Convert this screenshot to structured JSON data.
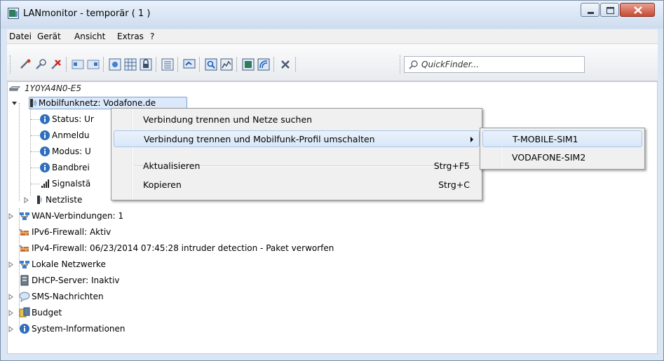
{
  "window": {
    "title": "LANmonitor - temporär ( 1 )"
  },
  "menubar": [
    "Datei",
    "Gerät",
    "Ansicht",
    "Extras",
    "?"
  ],
  "quickfinder": {
    "placeholder": "QuickFinder..."
  },
  "tree": {
    "device": "1Y0YA4N0-E5",
    "mobile": "Mobilfunknetz: Vodafone.de",
    "children": [
      "Status: Ur",
      "Anmeldu",
      "Modus: U",
      "Bandbrei",
      "Signalstä",
      "Netzliste"
    ],
    "root_items": [
      "WAN-Verbindungen: 1",
      "IPv6-Firewall: Aktiv",
      "IPv4-Firewall: 06/23/2014 07:45:28 intruder detection - Paket verworfen",
      "Lokale Netzwerke",
      "DHCP-Server: Inaktiv",
      "SMS-Nachrichten",
      "Budget",
      "System-Informationen"
    ]
  },
  "context_menu": {
    "items": [
      {
        "label": "Verbindung trennen und Netze suchen",
        "shortcut": ""
      },
      {
        "label": "Verbindung trennen und Mobilfunk-Profil umschalten",
        "shortcut": ""
      },
      {
        "label": "Aktualisieren",
        "shortcut": "Strg+F5"
      },
      {
        "label": "Kopieren",
        "shortcut": "Strg+C"
      }
    ]
  },
  "submenu": {
    "items": [
      "T-MOBILE-SIM1",
      "VODAFONE-SIM2"
    ]
  }
}
